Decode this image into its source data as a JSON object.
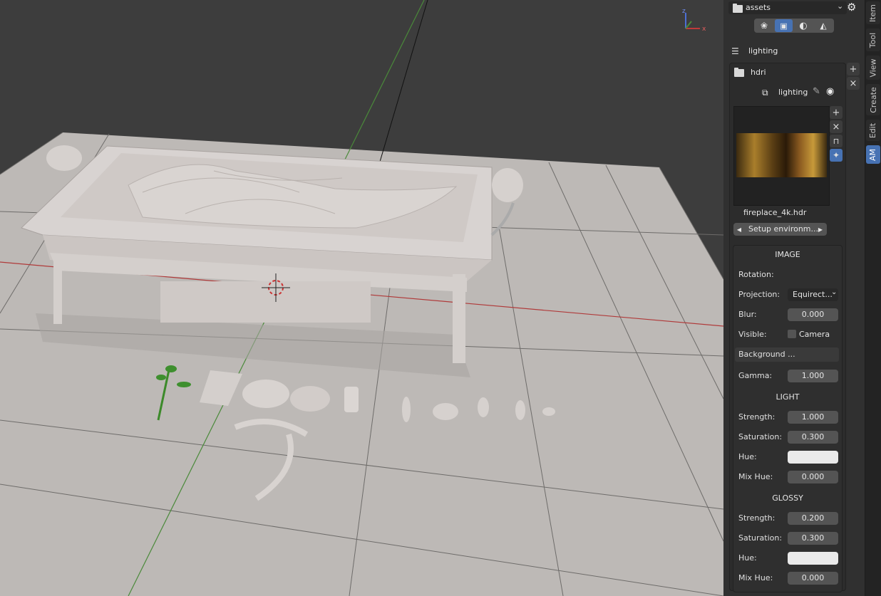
{
  "panel": {
    "library": {
      "name": "assets",
      "chevron": "chevron-down-icon",
      "settings": "gear-icon"
    },
    "header_icons": [
      "object-icon",
      "render-icon",
      "material-icon",
      "world-icon"
    ],
    "category": "lighting",
    "folder": "hdri",
    "asset_type": "lighting",
    "preview": {
      "filename": "fireplace_4k.hdr",
      "nav_label": "Setup environm..."
    },
    "image": {
      "title": "IMAGE",
      "rotation_label": "Rotation:",
      "projection_label": "Projection:",
      "projection_value": "Equirect...",
      "blur_label": "Blur:",
      "blur_value": "0.000",
      "visible_label": "Visible:",
      "visible_option": "Camera",
      "background_label": "Background ...",
      "gamma_label": "Gamma:",
      "gamma_value": "1.000"
    },
    "light": {
      "title": "LIGHT",
      "strength_label": "Strength:",
      "strength_value": "1.000",
      "saturation_label": "Saturation:",
      "saturation_value": "0.300",
      "hue_label": "Hue:",
      "mix_hue_label": "Mix Hue:",
      "mix_hue_value": "0.000"
    },
    "glossy": {
      "title": "GLOSSY",
      "strength_label": "Strength:",
      "strength_value": "0.200",
      "saturation_label": "Saturation:",
      "saturation_value": "0.300",
      "hue_label": "Hue:",
      "mix_hue_label": "Mix Hue:",
      "mix_hue_value": "0.000"
    }
  },
  "sidebar_tabs": [
    {
      "label": "Item",
      "active": false
    },
    {
      "label": "Tool",
      "active": false
    },
    {
      "label": "View",
      "active": false
    },
    {
      "label": "Create",
      "active": false
    },
    {
      "label": "Edit",
      "active": false
    },
    {
      "label": "AM",
      "active": true
    }
  ],
  "viewport": {
    "gizmo": {
      "z": "z",
      "x": "x"
    },
    "colors": {
      "floor": "#bfbbb8",
      "background": "#3d3d3d",
      "x_axis": "#b03a3a",
      "y_axis": "#4a8a3a"
    }
  }
}
